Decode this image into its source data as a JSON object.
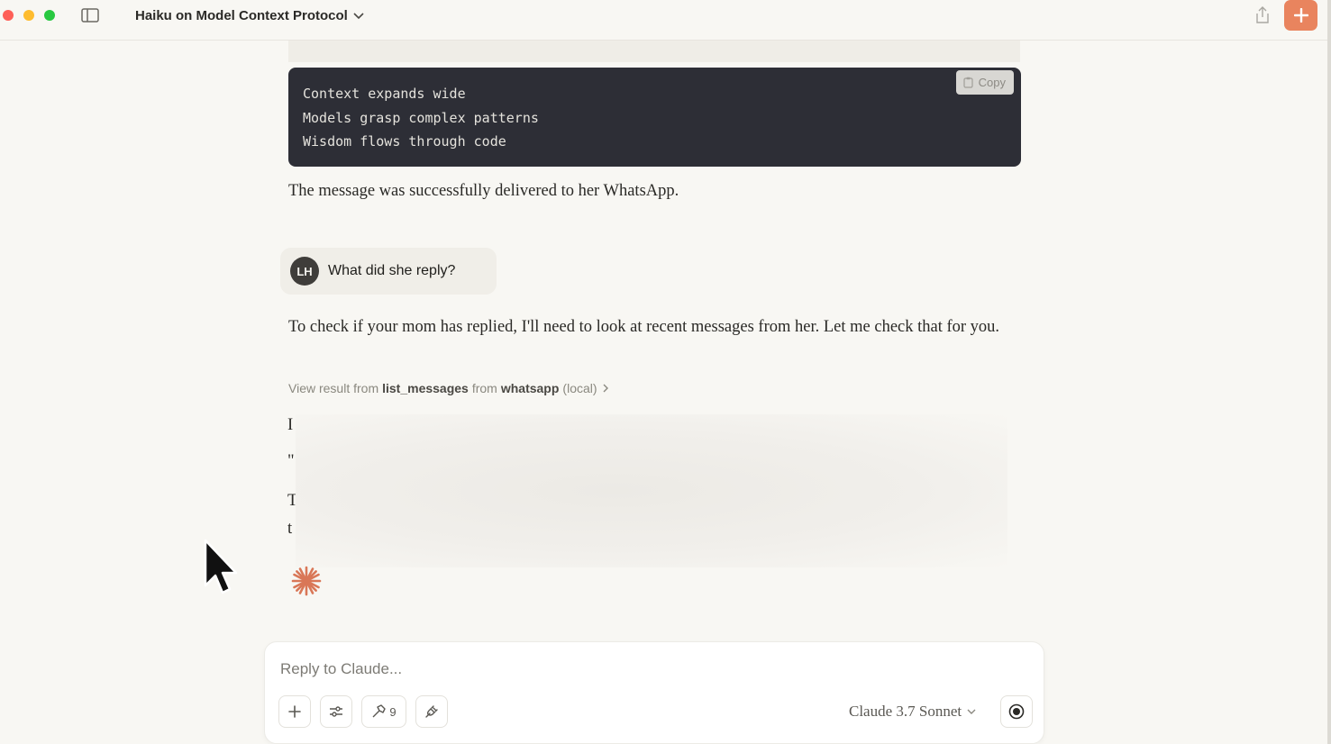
{
  "window": {
    "title": "Haiku on Model Context Protocol"
  },
  "code_block": {
    "lines": [
      "Context expands wide",
      "Models grasp complex patterns",
      "Wisdom flows through code"
    ],
    "copy_label": "Copy"
  },
  "conversation": {
    "assistant_msg_1": "The message was successfully delivered to her WhatsApp.",
    "user_avatar_initials": "LH",
    "user_msg": "What did she reply?",
    "assistant_msg_2": "To check if your mom has replied, I'll need to look at recent messages from her. Let me check that for you.",
    "tool_result": {
      "prefix": "View result from",
      "tool": "list_messages",
      "middle": "from",
      "server": "whatsapp",
      "suffix": "(local)"
    },
    "partial_chars": [
      "I",
      "\"",
      "T",
      "t"
    ]
  },
  "composer": {
    "placeholder": "Reply to Claude...",
    "tools_count": "9",
    "model": "Claude 3.7 Sonnet"
  },
  "colors": {
    "accent": "#e9845e",
    "code_bg": "#2d2e36",
    "page_bg": "#f8f7f3",
    "spark": "#d97757"
  }
}
